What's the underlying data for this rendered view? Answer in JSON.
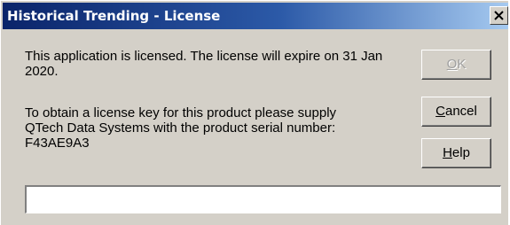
{
  "window": {
    "title": "Historical Trending - License"
  },
  "message": {
    "license_status": "This application is licensed. The license will expire on 31 Jan 2020.",
    "obtain_key_line1": "To obtain a license key for this product please supply",
    "obtain_key_line2": "QTech Data Systems with the product serial number:",
    "serial_number": "F43AE9A3"
  },
  "buttons": {
    "ok": {
      "mnemonic": "O",
      "rest": "K",
      "enabled": false
    },
    "cancel": {
      "mnemonic": "C",
      "rest": "ancel"
    },
    "help": {
      "mnemonic": "H",
      "rest": "elp"
    }
  },
  "license_input": {
    "value": ""
  },
  "icons": {
    "close": "close-icon"
  },
  "colors": {
    "dialog_face": "#d4d0c8",
    "title_start": "#0a246a",
    "title_end": "#a6caf0"
  }
}
